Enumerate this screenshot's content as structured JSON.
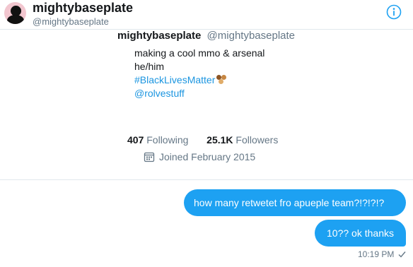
{
  "header": {
    "display_name": "mightybaseplate",
    "handle": "@mightybaseplate",
    "info_icon": "info-icon",
    "avatar_icon": "avatar-silhouette"
  },
  "profile": {
    "display_name": "mightybaseplate",
    "handle": "@mightybaseplate",
    "bio_lines": [
      "making a cool mmo & arsenal",
      "he/him"
    ],
    "hashtag": "#BlackLivesMatter",
    "mention": "@rolvestuff",
    "following_count": "407",
    "following_label": "Following",
    "followers_count": "25.1K",
    "followers_label": "Followers",
    "joined": "Joined February 2015",
    "joined_icon": "calendar-icon"
  },
  "messages": [
    {
      "text": "how many retwetet fro apueple team?!?!?!?",
      "sender": "self"
    },
    {
      "text": "10?? ok thanks",
      "sender": "self"
    }
  ],
  "last_message_time": "10:19 PM",
  "colors": {
    "accent": "#1da1f2",
    "link": "#1b95e0",
    "secondary_text": "#657786"
  }
}
